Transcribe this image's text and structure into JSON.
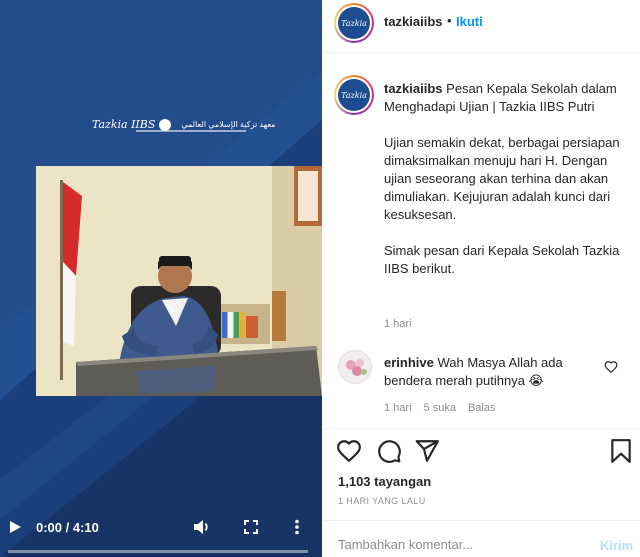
{
  "video": {
    "school_logo_text": "Tazkia IIBS",
    "arabic_text": "معهد تزكية الإسلامي العالمي",
    "controls": {
      "time": "0:00 / 4:10",
      "progress_fraction": 0.0,
      "play_icon": "play-icon",
      "volume_icon": "volume-icon",
      "fullscreen_icon": "fullscreen-icon",
      "more_icon": "more-vertical-icon"
    }
  },
  "post": {
    "header": {
      "username": "tazkiaiibs",
      "separator": "•",
      "follow_label": "Ikuti"
    },
    "caption": {
      "username": "tazkiaiibs",
      "title": "Pesan Kepala Sekolah dalam Menghadapi Ujian | Tazkia IIBS Putri",
      "paragraph_1": "Ujian semakin dekat, berbagai persiapan dimaksimalkan menuju hari H. Dengan ujian seseorang akan terhina dan akan dimuliakan. Kejujuran adalah kunci dari kesuksesan.",
      "paragraph_2": "Simak pesan dari Kepala Sekolah Tazkia IIBS berikut.",
      "time": "1 hari"
    },
    "comment": {
      "username": "erinhive",
      "text": "Wah Masya Allah ada bendera merah putihnya 😭",
      "time": "1 hari",
      "likes": "5 suka",
      "reply_label": "Balas"
    },
    "actions": {
      "like_icon": "heart-icon",
      "comment_icon": "comment-icon",
      "share_icon": "send-icon",
      "save_icon": "bookmark-icon"
    },
    "views": "1,103 tayangan",
    "date": "1 HARI YANG LALU",
    "add_comment": {
      "placeholder": "Tambahkan komentar...",
      "post_label": "Kirim"
    }
  },
  "colors": {
    "video_blue": "#1b3f7a",
    "link_blue": "#0095f6",
    "post_disabled": "#b2dffc",
    "muted": "#8e8e8e"
  }
}
